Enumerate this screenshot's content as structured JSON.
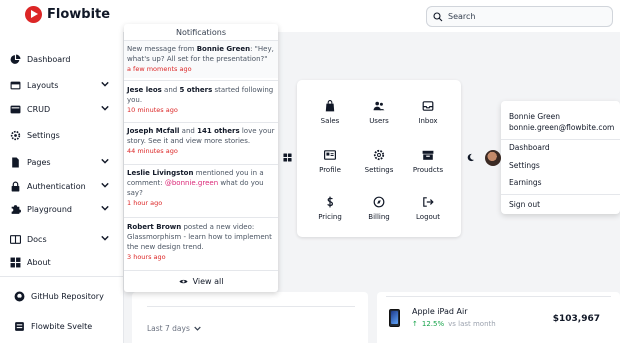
{
  "brand": {
    "name": "Flowbite"
  },
  "search": {
    "placeholder": "Search"
  },
  "sidebar": {
    "items": [
      {
        "label": "Dashboard",
        "icon": "pie-chart-icon"
      },
      {
        "label": "Layouts",
        "icon": "layout-icon"
      },
      {
        "label": "CRUD",
        "icon": "crud-icon"
      },
      {
        "label": "Settings",
        "icon": "gear-icon"
      },
      {
        "label": "Pages",
        "icon": "pages-icon"
      },
      {
        "label": "Authentication",
        "icon": "lock-icon"
      },
      {
        "label": "Playground",
        "icon": "puzzle-icon"
      },
      {
        "label": "Docs",
        "icon": "book-icon"
      },
      {
        "label": "About",
        "icon": "grid-icon"
      },
      {
        "label": "GitHub Repository",
        "icon": "github-icon"
      },
      {
        "label": "Flowbite Svelte",
        "icon": "svelte-icon"
      }
    ]
  },
  "notifications": {
    "title": "Notifications",
    "items": [
      {
        "name": "Bonnie Green",
        "pre": "New message from ",
        "text": ": \"Hey, what's up? All set for the presentation?\"",
        "time": "a few moments ago"
      },
      {
        "name": "Jese leos",
        "mid": " and ",
        "name2": "5 others",
        "text": " started following you.",
        "time": "10 minutes ago"
      },
      {
        "name": "Joseph Mcfall",
        "mid": " and ",
        "name2": "141 others",
        "text": " love your story. See it and view more stories.",
        "time": "44 minutes ago"
      },
      {
        "name": "Leslie Livingston",
        "text": " mentioned you in a comment: ",
        "mention": "@bonnie.green",
        "text2": " what do you say?",
        "time": "1 hour ago"
      },
      {
        "name": "Robert Brown",
        "text": " posted a new video: Glassmorphism - learn how to implement the new design trend.",
        "time": "3 hours ago"
      }
    ],
    "view_all": "View all"
  },
  "apps": [
    {
      "label": "Sales",
      "icon": "bag-icon"
    },
    {
      "label": "Users",
      "icon": "users-icon"
    },
    {
      "label": "Inbox",
      "icon": "inbox-icon"
    },
    {
      "label": "Profile",
      "icon": "profile-card-icon"
    },
    {
      "label": "Settings",
      "icon": "gear-icon"
    },
    {
      "label": "Proudcts",
      "icon": "archive-icon"
    },
    {
      "label": "Pricing",
      "icon": "dollar-icon"
    },
    {
      "label": "Billing",
      "icon": "compass-icon"
    },
    {
      "label": "Logout",
      "icon": "logout-icon"
    }
  ],
  "user_menu": {
    "name": "Bonnie Green",
    "email": "bonnie.green@flowbite.com",
    "items": [
      "Dashboard",
      "Settings",
      "Earnings",
      "Sign out"
    ]
  },
  "main": {
    "period": "Last 7 days"
  },
  "product": {
    "name": "Apple iPad Air",
    "change": "12.5%",
    "change_note": "vs last month",
    "price": "$103,967"
  },
  "colors": {
    "brand_red": "#dc2626",
    "up_green": "#16a34a",
    "time_red": "#dc2626",
    "mention_pink": "#db2777"
  }
}
